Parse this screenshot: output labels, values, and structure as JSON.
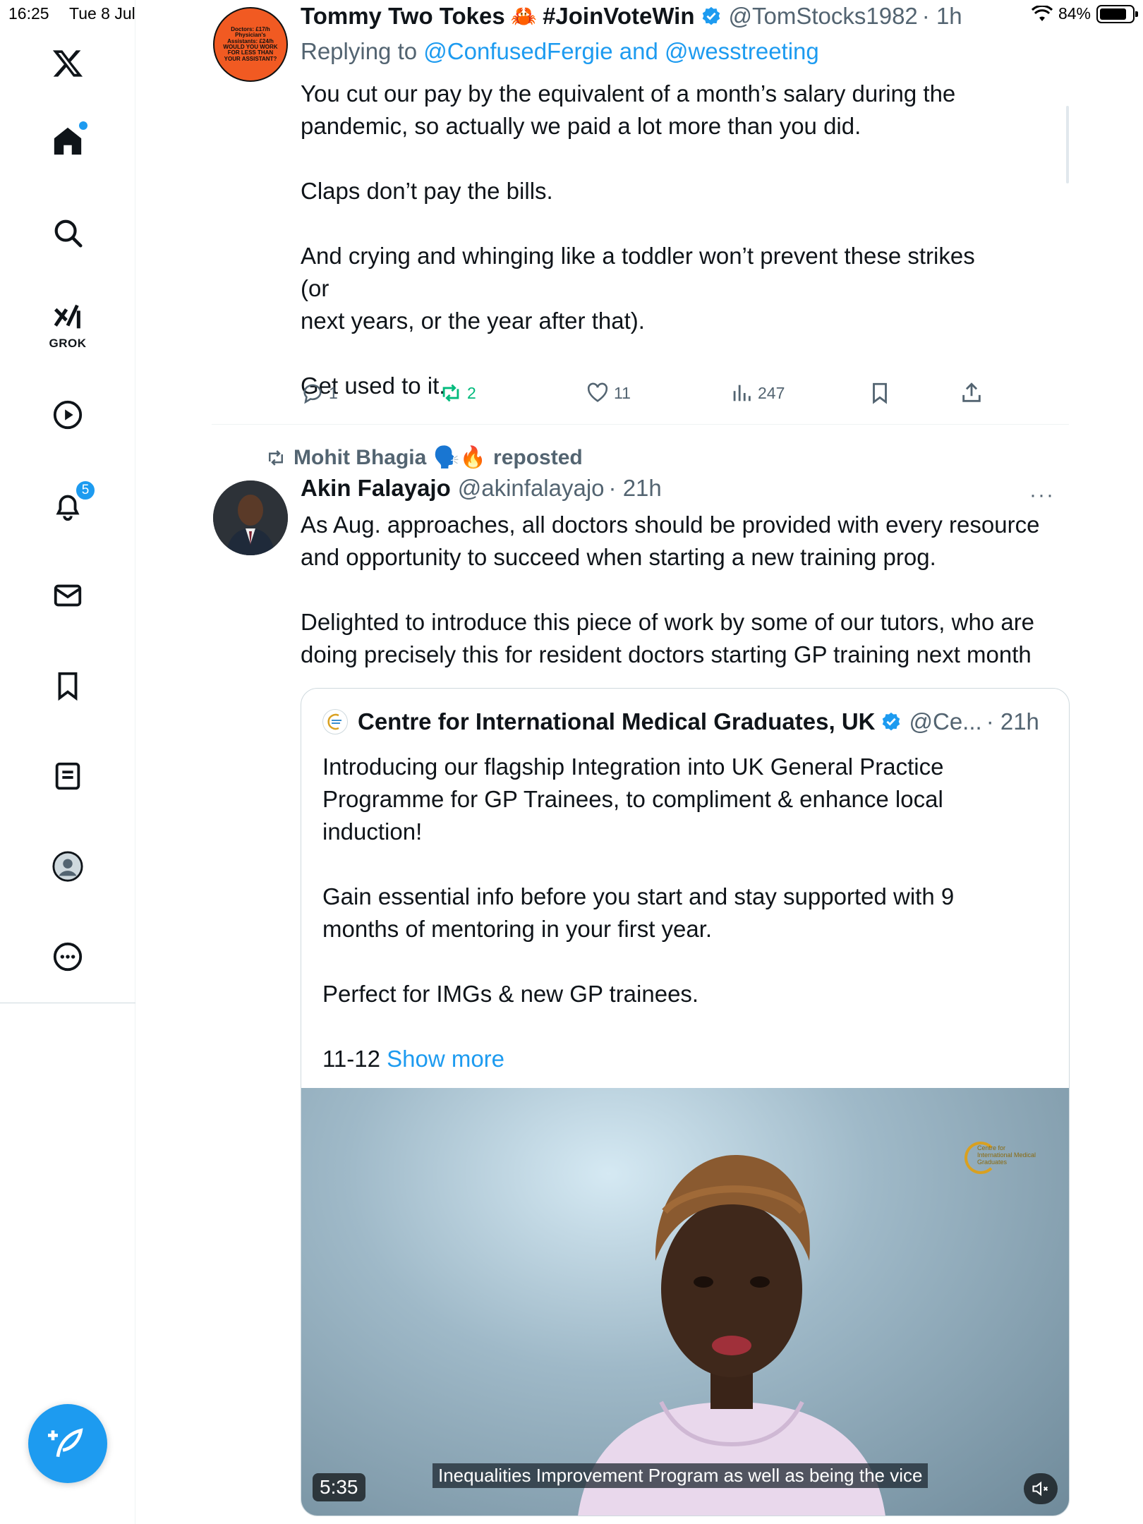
{
  "status_bar": {
    "time": "16:25",
    "date": "Tue 8 Jul",
    "battery": "84%",
    "battery_level": 0.84
  },
  "sidebar": {
    "items": [
      {
        "name": "x-logo",
        "icon": "x-logo-icon"
      },
      {
        "name": "home",
        "icon": "home-icon",
        "has_dot": true
      },
      {
        "name": "search",
        "icon": "search-icon"
      },
      {
        "name": "grok",
        "icon": "grok-icon",
        "label": "GROK"
      },
      {
        "name": "video",
        "icon": "play-icon"
      },
      {
        "name": "notifications",
        "icon": "bell-icon",
        "badge": "5"
      },
      {
        "name": "messages",
        "icon": "mail-icon"
      },
      {
        "name": "bookmarks",
        "icon": "bookmark-icon"
      },
      {
        "name": "lists",
        "icon": "list-icon"
      },
      {
        "name": "profile",
        "icon": "profile-icon"
      },
      {
        "name": "more",
        "icon": "more-icon"
      }
    ],
    "compose_icon": "compose-icon"
  },
  "tweet1": {
    "avatar_text": "Doctors: £17/h Physician's Assistants: £24/h WOULD YOU WORK FOR LESS THAN YOUR ASSISTANT?",
    "name": "Tommy Two Tokes",
    "name_emoji": "🦀",
    "name_tag": "#JoinVoteWin",
    "handle": "@TomStocks1982",
    "time": "· 1h",
    "replying_to_label": "Replying to",
    "reply_user_1": "@ConfusedFergie",
    "reply_and": "and",
    "reply_user_2": "@wesstreeting",
    "text": "You cut our pay by the equivalent of a month’s salary during the\npandemic, so actually we paid a lot more than you did.\n\nClaps don’t pay the bills.\n\nAnd crying and whinging like a toddler won’t prevent these strikes (or\nnext years, or the year after that).\n\nGet used to it.",
    "replies": "1",
    "reposts": "2",
    "likes": "11",
    "views": "247"
  },
  "tweet2": {
    "reposted_by": "Mohit Bhagia",
    "reposted_emojis": "🗣️🔥",
    "reposted_label": "reposted",
    "name": "Akin Falayajo",
    "handle": "@akinfalayajo",
    "time": "· 21h",
    "more": "···",
    "text": "As Aug. approaches, all doctors should be provided with every resource\nand opportunity to succeed when starting a new training prog.\n\nDelighted to introduce this piece of work by some of our tutors, who are\ndoing precisely this for resident doctors starting GP training next month",
    "quote": {
      "name": "Centre for International Medical Graduates, UK",
      "handle": "@Ce...",
      "time": "· 21h",
      "text": "Introducing our flagship Integration into UK General Practice\nProgramme for GP Trainees, to compliment & enhance local\ninduction!\n\nGain essential info before you start and stay supported with 9\nmonths of mentoring in your first year.\n\nPerfect for IMGs & new GP trainees.\n\n11-12",
      "show_more": "Show more",
      "video": {
        "logo_text": "Centre for International Medical Graduates",
        "subtitle": "Inequalities Improvement Program as well as being the vice",
        "duration": "5:35"
      }
    }
  },
  "colors": {
    "accent": "#1d9bf0",
    "repost_green": "#00ba7c",
    "secondary_text": "#536471"
  }
}
